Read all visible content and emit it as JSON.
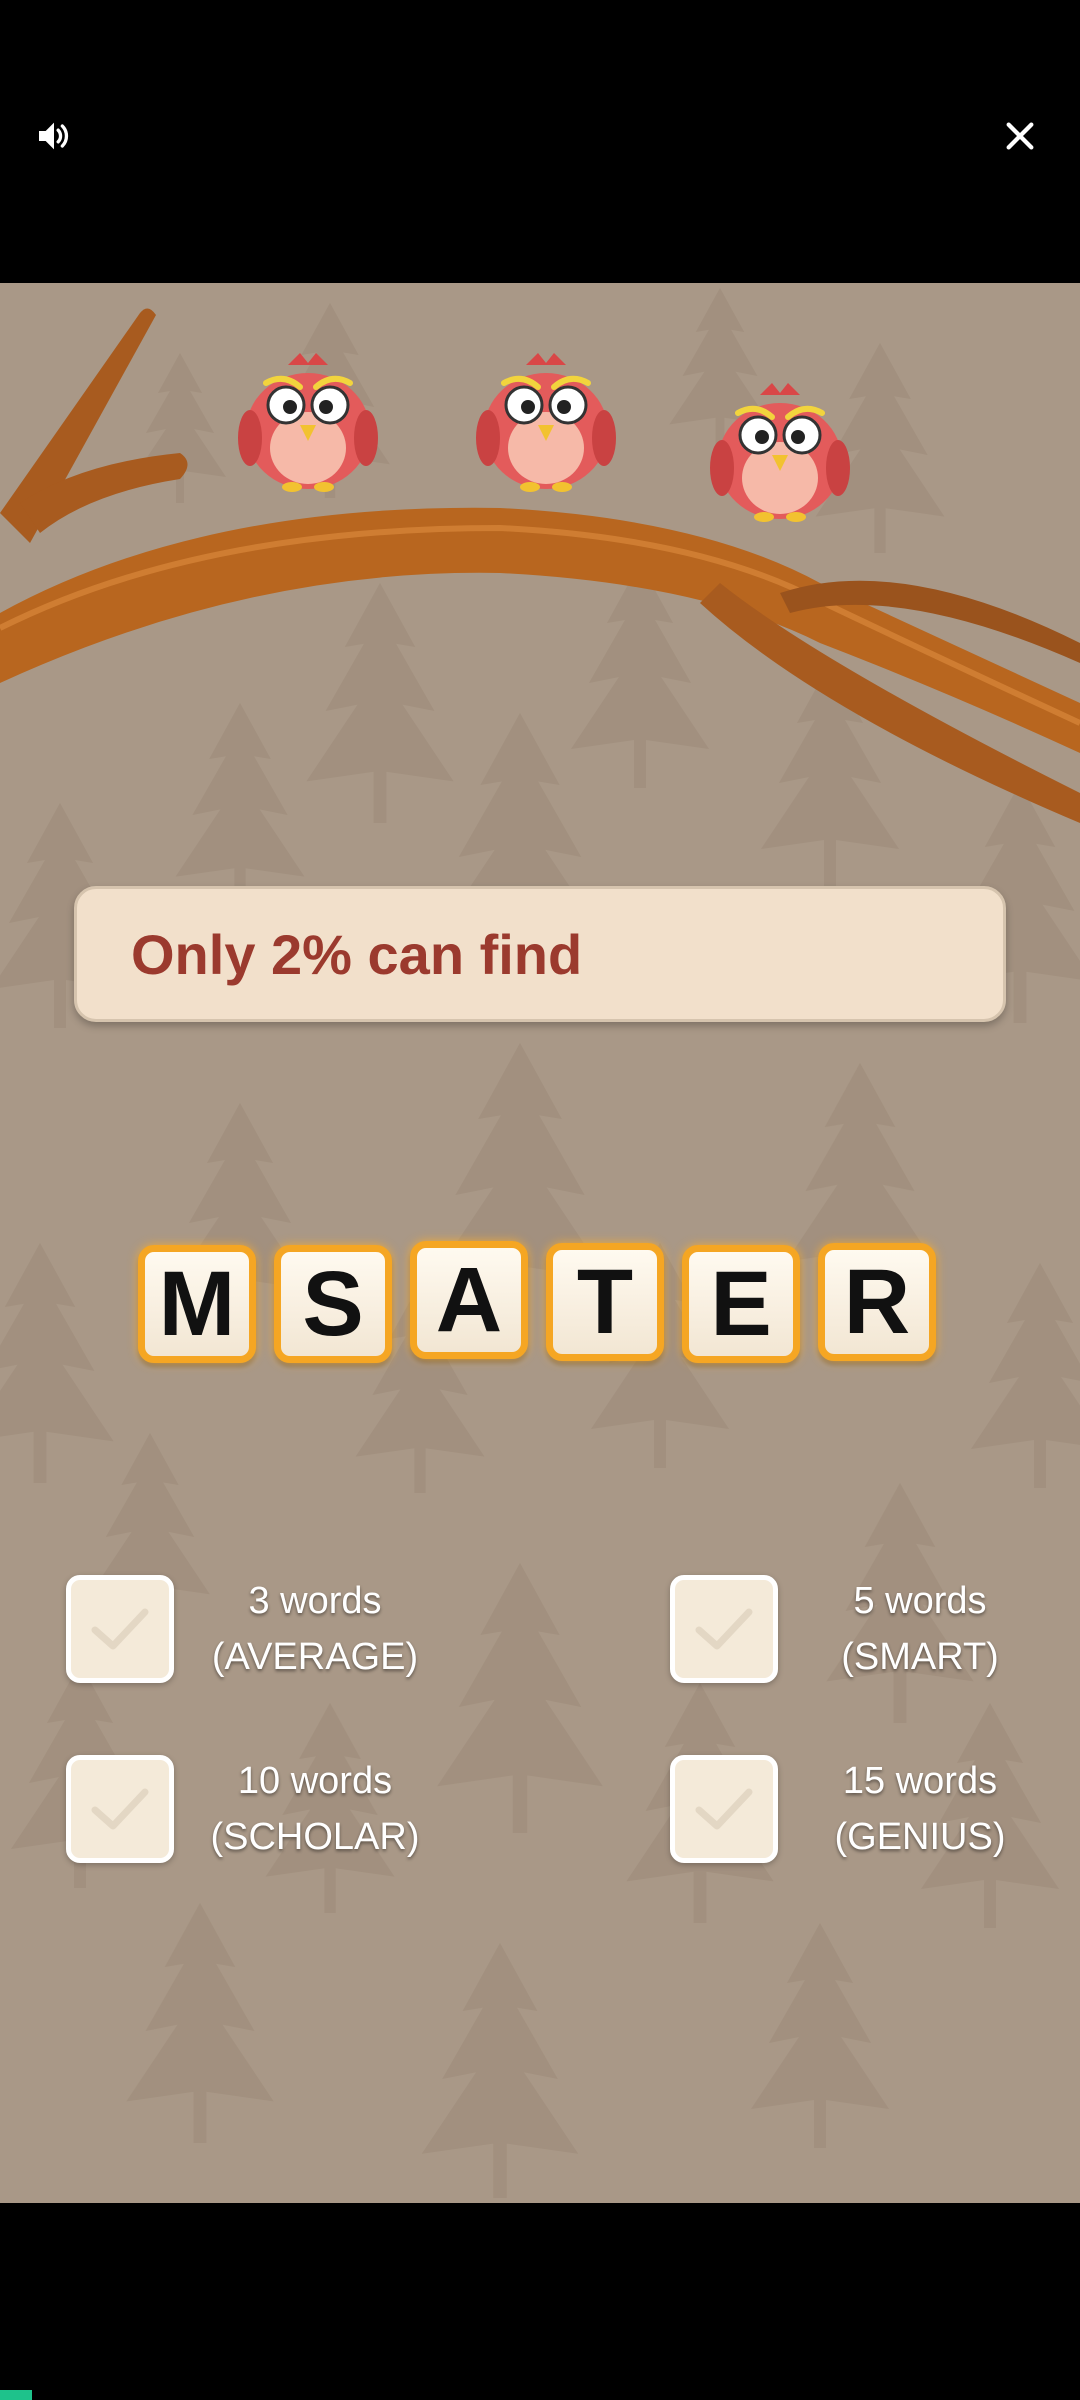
{
  "controls": {
    "sound_icon": "speaker-volume-icon",
    "close_icon": "close-x-icon"
  },
  "ad": {
    "banner_text": "Only 2% can find",
    "letters": [
      "M",
      "S",
      "A",
      "T",
      "E",
      "R"
    ],
    "goals": [
      {
        "count": "3 words",
        "level": "(AVERAGE)"
      },
      {
        "count": "5 words",
        "level": "(SMART)"
      },
      {
        "count": "10 words",
        "level": "(SCHOLAR)"
      },
      {
        "count": "15 words",
        "level": "(GENIUS)"
      }
    ]
  },
  "colors": {
    "background": "#a99887",
    "banner_bg": "#f2e0cb",
    "banner_text": "#9b3a2e",
    "tile_border": "#f5a623",
    "progress": "#1ec28b"
  },
  "progress": {
    "fraction": 0.03
  }
}
